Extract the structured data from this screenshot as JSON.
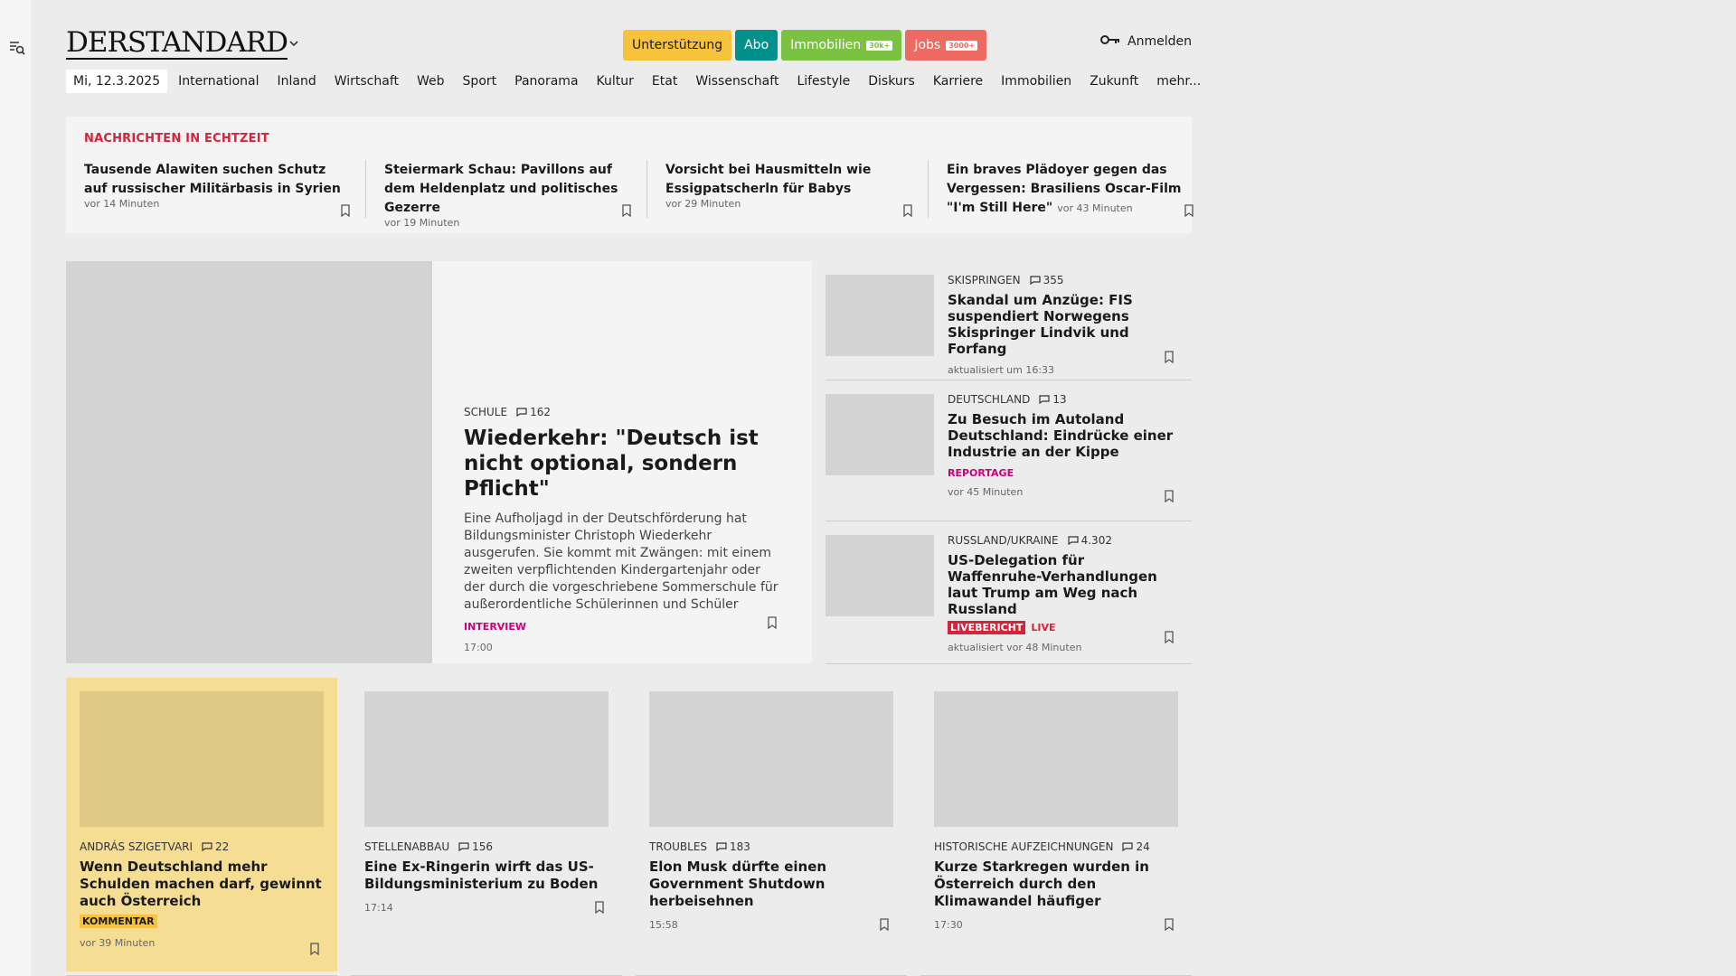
{
  "header": {
    "logo": "DERSTANDARD",
    "pills": {
      "support": "Unterstützung",
      "abo": "Abo",
      "immo": "Immobilien",
      "immo_tag": "30k+",
      "jobs": "Jobs",
      "jobs_tag": "3000+"
    },
    "login": "Anmelden"
  },
  "nav": {
    "date": "Mi, 12.3.2025",
    "items": [
      "International",
      "Inland",
      "Wirtschaft",
      "Web",
      "Sport",
      "Panorama",
      "Kultur",
      "Etat",
      "Wissenschaft",
      "Lifestyle",
      "Diskurs",
      "Karriere",
      "Immobilien",
      "Zukunft",
      "mehr..."
    ]
  },
  "ticker": {
    "title": "NACHRICHTEN IN ECHTZEIT",
    "items": [
      {
        "title": "Tausende Alawiten suchen Schutz auf russischer Militärbasis in Syrien",
        "time": "vor 14 Minuten"
      },
      {
        "title": "Steiermark Schau: Pavillons auf dem Heldenplatz und politisches Gezerre",
        "time": "vor 19 Minuten"
      },
      {
        "title": "Vorsicht bei Hausmitteln wie Essigpatscherln für Babys",
        "time": "vor 29 Minuten"
      },
      {
        "title": "Ein braves Plädoyer gegen das Vergessen: Brasiliens Oscar-Film \"I'm Still Here\"",
        "time": "vor 43 Minuten"
      }
    ]
  },
  "lead": {
    "kicker": "SCHULE",
    "comments": "162",
    "title": "Wiederkehr: \"Deutsch ist nicht optional, sondern Pflicht\"",
    "teaser": "Eine Aufholjagd in der Deutschförderung hat Bildungsminister Christoph Wiederkehr ausgerufen. Sie kommt mit Zwängen: mit einem zweiten verpflichtenden Kindergartenjahr oder der durch die vorgeschriebene Sommerschule für außerordentliche Schülerinnen und Schüler",
    "genre": "INTERVIEW",
    "time": "17:00"
  },
  "side": [
    {
      "kicker": "SKISPRINGEN",
      "comments": "355",
      "title": "Skandal um Anzüge: FIS suspendiert Norwegens Skispringer Lindvik und Forfang",
      "time": "aktualisiert um 16:33"
    },
    {
      "kicker": "DEUTSCHLAND",
      "comments": "13",
      "title": "Zu Besuch im Autoland Deutschland: Eindrücke einer Industrie an der Kippe",
      "genre": "REPORTAGE",
      "time": "vor 45 Minuten"
    },
    {
      "kicker": "RUSSLAND/UKRAINE",
      "comments": "4.302",
      "title": "US-Delegation für Waffenruhe-Verhandlungen laut Trump am Weg nach Russland",
      "liveb": "LIVEBERICHT",
      "live": "LIVE",
      "time": "aktualisiert vor 48 Minuten"
    }
  ],
  "cards": [
    {
      "kicker": "ANDRÁS SZIGETVARI",
      "comments": "22",
      "title": "Wenn Deutschland mehr Schulden machen darf, gewinnt auch Österreich",
      "genre": "KOMMENTAR",
      "time": "vor 39 Minuten"
    },
    {
      "kicker": "STELLENABBAU",
      "comments": "156",
      "title": "Eine Ex-Ringerin wirft das US-Bildungsministerium zu Boden",
      "time": "17:14"
    },
    {
      "kicker": "TROUBLES",
      "comments": "183",
      "title": "Elon Musk dürfte einen Government Shutdown herbeisehnen",
      "time": "15:58"
    },
    {
      "kicker": "HISTORISCHE AUFZEICHNUNGEN",
      "comments": "24",
      "title": "Kurze Starkregen wurden in Österreich durch den Klimawandel häufiger",
      "time": "17:30"
    }
  ]
}
